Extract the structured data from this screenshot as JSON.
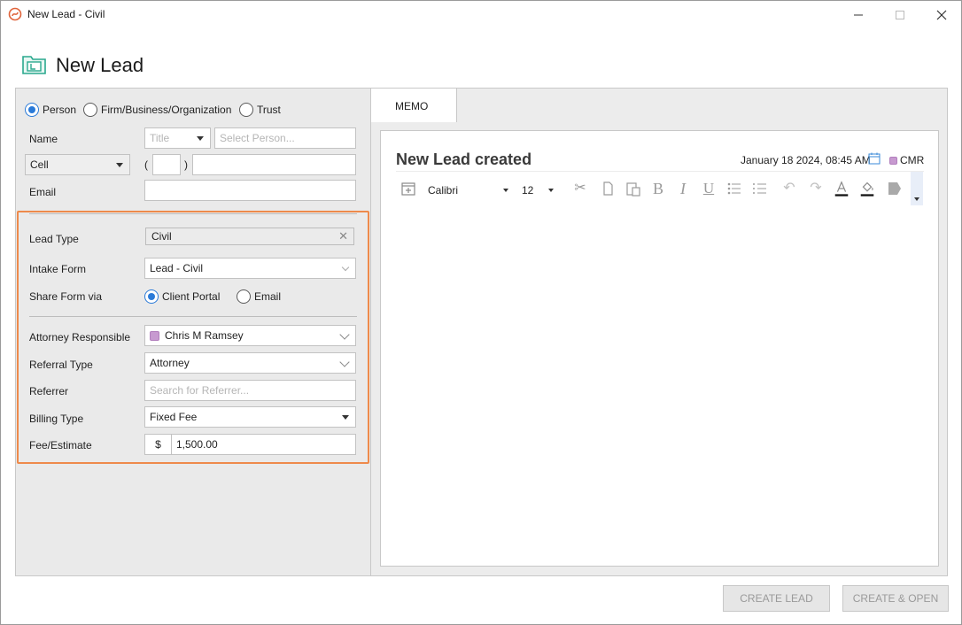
{
  "window": {
    "title": "New Lead - Civil",
    "minimize_icon": "minimize-icon",
    "maximize_icon": "maximize-icon",
    "close_icon": "close-icon"
  },
  "header": {
    "title": "New Lead",
    "icon": "lead-folder-icon",
    "icon_color": "#2aa88e"
  },
  "contact": {
    "type_options": [
      {
        "label": "Person",
        "selected": true
      },
      {
        "label": "Firm/Business/Organization",
        "selected": false
      },
      {
        "label": "Trust",
        "selected": false
      }
    ],
    "name_label": "Name",
    "title_placeholder": "Title",
    "person_placeholder": "Select Person...",
    "phone_type": "Cell",
    "phone_open_paren": "(",
    "phone_close_paren": ")",
    "area_code": "",
    "phone_number": "",
    "email_label": "Email",
    "email_value": ""
  },
  "lead": {
    "lead_type_label": "Lead Type",
    "lead_type_value": "Civil",
    "intake_form_label": "Intake Form",
    "intake_form_value": "Lead - Civil",
    "share_form_label": "Share Form via",
    "share_options": [
      {
        "label": "Client Portal",
        "selected": true
      },
      {
        "label": "Email",
        "selected": false
      }
    ],
    "attorney_label": "Attorney Responsible",
    "attorney_value": "Chris M Ramsey",
    "attorney_color": "#c79ad0",
    "referral_type_label": "Referral Type",
    "referral_type_value": "Attorney",
    "referrer_label": "Referrer",
    "referrer_placeholder": "Search for Referrer...",
    "billing_type_label": "Billing Type",
    "billing_type_value": "Fixed Fee",
    "fee_label": "Fee/Estimate",
    "fee_currency": "$",
    "fee_value": "1,500.00",
    "highlight_color": "#ee8a4b"
  },
  "memo": {
    "tab_label": "MEMO",
    "title": "New Lead created",
    "date": "January 18 2024, 08:45 AM",
    "user": "CMR",
    "toolbar": {
      "font": "Calibri",
      "size": "12",
      "icons": [
        "insert-table-icon",
        "cut-icon",
        "copy-icon",
        "paste-icon",
        "bold-icon",
        "italic-icon",
        "underline-icon",
        "bullet-list-icon",
        "numbered-list-icon",
        "undo-icon",
        "redo-icon",
        "font-color-icon",
        "highlight-color-icon",
        "fill-icon"
      ]
    }
  },
  "actions": {
    "create_lead": "CREATE LEAD",
    "create_open": "CREATE & OPEN"
  }
}
